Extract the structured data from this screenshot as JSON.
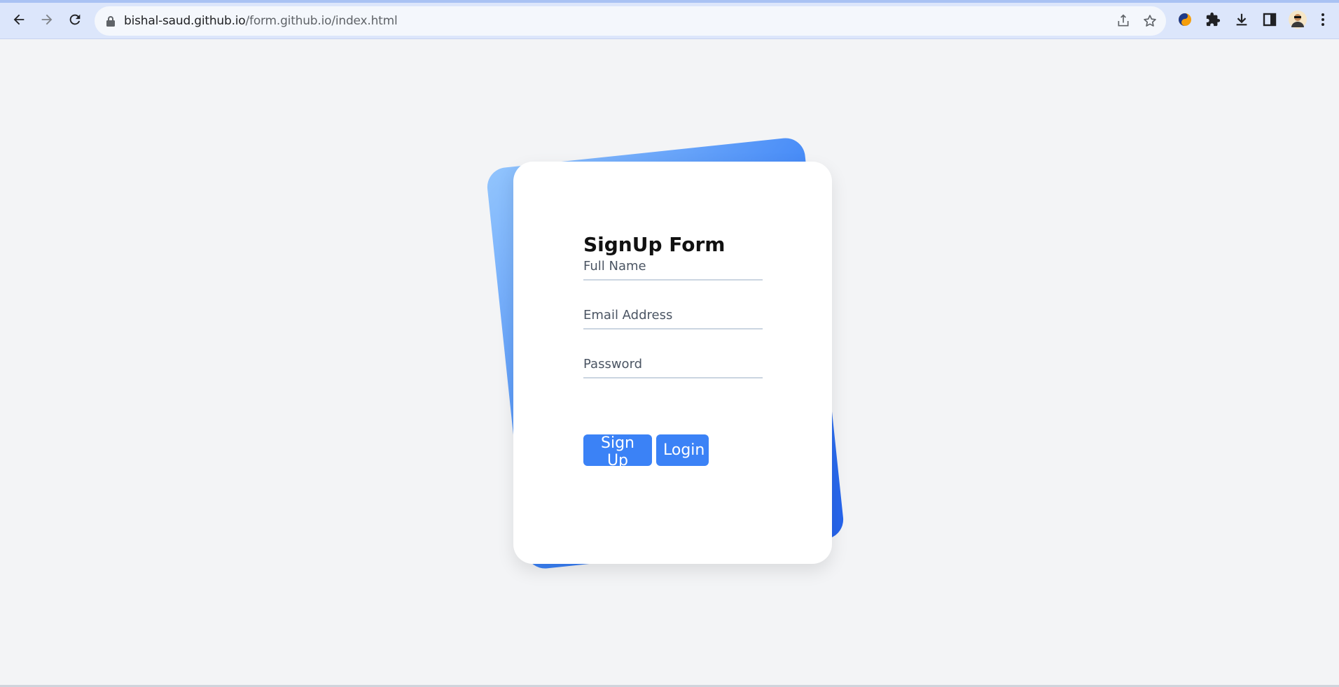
{
  "browser": {
    "url_host": "bishal-saud.github.io",
    "url_path": "/form.github.io/index.html",
    "icons": [
      "back-arrow-icon",
      "forward-arrow-icon",
      "reload-icon",
      "lock-icon",
      "share-icon",
      "star-icon",
      "extension-logo-icon",
      "puzzle-icon",
      "download-icon",
      "side-panel-icon",
      "avatar",
      "more-vert-icon"
    ]
  },
  "form": {
    "title": "SignUp Form",
    "full_name_placeholder": "Full Name",
    "email_placeholder": "Email Address",
    "password_placeholder": "Password",
    "signup_label": "Sign Up",
    "login_label": "Login"
  },
  "colors": {
    "accent": "#3b82f6",
    "gradient_start": "#93c5fd",
    "gradient_end": "#2563eb",
    "page_bg": "#f3f4f6"
  }
}
